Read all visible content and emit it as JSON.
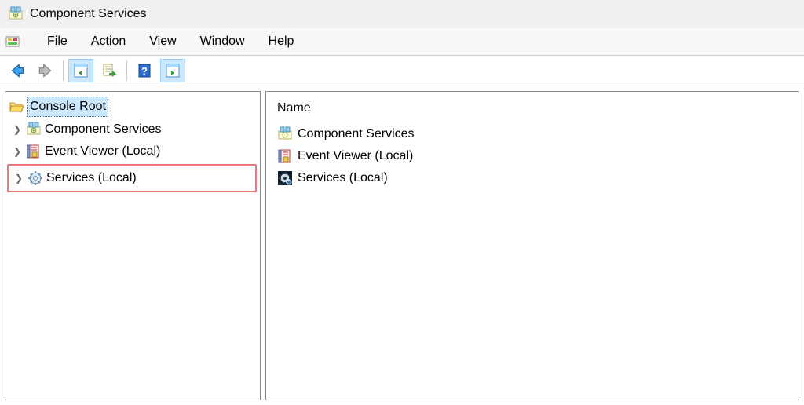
{
  "window": {
    "title": "Component Services"
  },
  "menu": {
    "file": "File",
    "action": "Action",
    "view": "View",
    "window": "Window",
    "help": "Help"
  },
  "tree": {
    "root": "Console Root",
    "items": [
      {
        "label": "Component Services"
      },
      {
        "label": "Event Viewer (Local)"
      },
      {
        "label": "Services (Local)"
      }
    ]
  },
  "detail": {
    "column_header": "Name",
    "rows": [
      {
        "label": "Component Services"
      },
      {
        "label": "Event Viewer (Local)"
      },
      {
        "label": "Services (Local)"
      }
    ]
  }
}
